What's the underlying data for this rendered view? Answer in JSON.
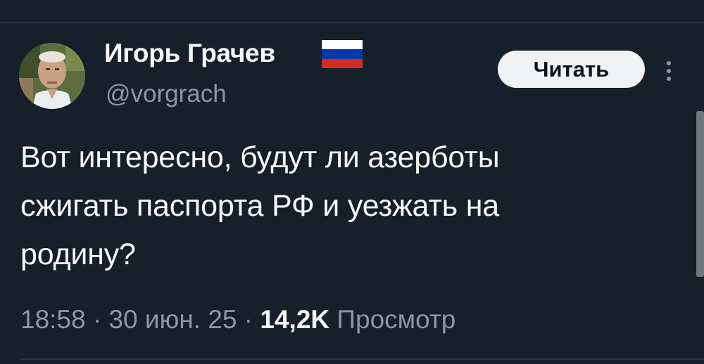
{
  "author": {
    "display_name": "Игорь Грачев",
    "handle": "@vorgrach",
    "avatar_icon": "person-photo-avatar",
    "flag_icon": "russia-flag-icon",
    "flag_colors": [
      "#ffffff",
      "#0039a6",
      "#d52b1e"
    ]
  },
  "actions": {
    "follow_label": "Читать",
    "more_icon": "vertical-ellipsis-icon"
  },
  "tweet": {
    "lines": [
      "Вот интересно, будут ли азерботы",
      "сжигать паспорта РФ и уезжать на",
      "родину?"
    ],
    "time": "18:58",
    "date": "30 июн. 25",
    "separator": "·",
    "views_count": "14,2K",
    "views_label": "Просмотр"
  },
  "colors": {
    "background": "#15202b",
    "text": "#f7f9f9",
    "secondary_text": "#8b98a5",
    "button_bg": "#eff3f4"
  }
}
